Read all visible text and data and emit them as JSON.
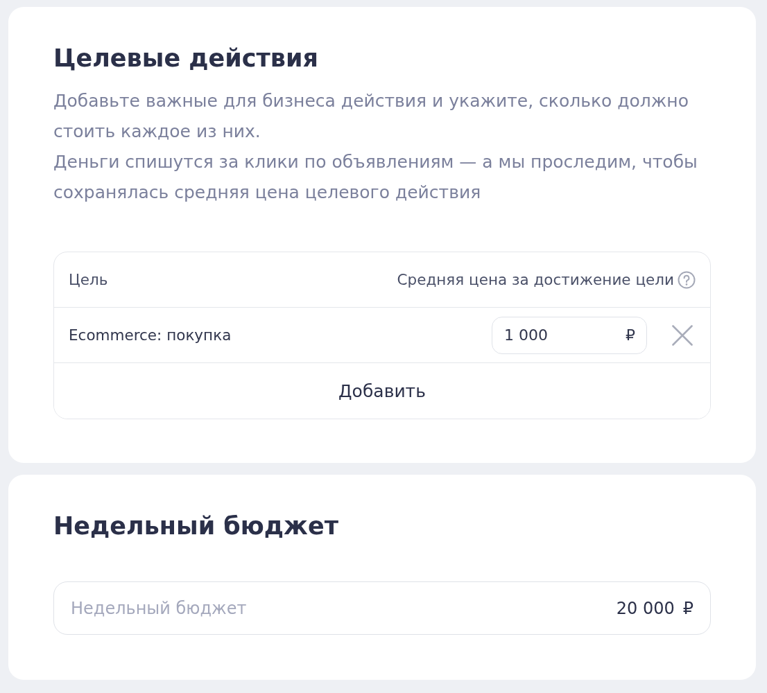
{
  "goals_section": {
    "title": "Целевые действия",
    "description": [
      "Добавьте важные для бизнеса действия и укажите, сколько должно стоить каждое из них.",
      "Деньги спишутся за клики по объявлениям — а мы проследим, чтобы сохранялась средняя цена целевого действия"
    ],
    "table": {
      "columns": [
        "Цель",
        "Средняя цена за достижение цели"
      ],
      "rows": [
        {
          "goal": "Ecommerce: покупка",
          "price": "1 000",
          "currency": "₽"
        }
      ],
      "add_button": "Добавить"
    }
  },
  "budget_section": {
    "title": "Недельный бюджет",
    "field": {
      "label": "Недельный бюджет",
      "value": "20 000",
      "currency": "₽"
    }
  }
}
